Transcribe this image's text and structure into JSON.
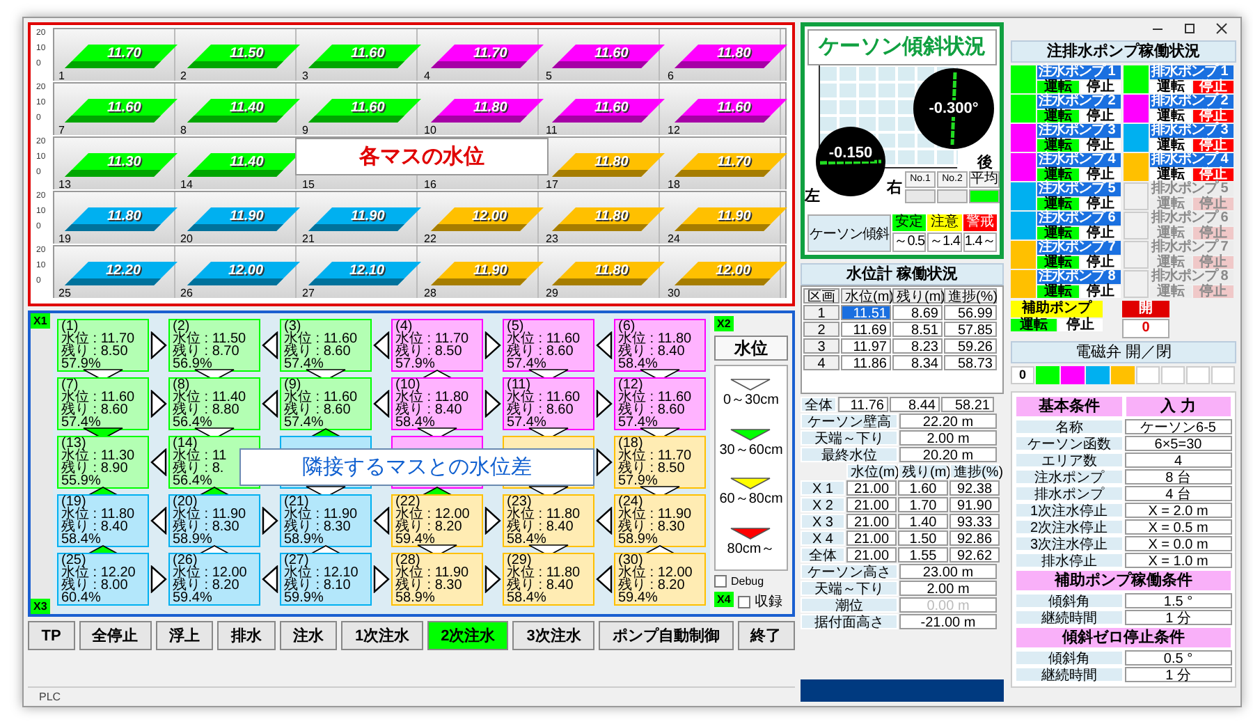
{
  "level_chart": {
    "overlay": "各マスの水位",
    "rows": [
      {
        "ticks": [
          "20",
          "10",
          "0"
        ],
        "bars": [
          {
            "index": "1",
            "value": "11.70",
            "color": "#00ff00"
          },
          {
            "index": "2",
            "value": "11.50",
            "color": "#00ff00"
          },
          {
            "index": "3",
            "value": "11.60",
            "color": "#00ff00"
          },
          {
            "index": "4",
            "value": "11.70",
            "color": "#ff00ff"
          },
          {
            "index": "5",
            "value": "11.60",
            "color": "#ff00ff"
          },
          {
            "index": "6",
            "value": "11.80",
            "color": "#ff00ff"
          }
        ]
      },
      {
        "ticks": [
          "20",
          "10",
          "0"
        ],
        "bars": [
          {
            "index": "7",
            "value": "11.60",
            "color": "#00ff00"
          },
          {
            "index": "8",
            "value": "11.40",
            "color": "#00ff00"
          },
          {
            "index": "9",
            "value": "11.60",
            "color": "#00ff00"
          },
          {
            "index": "10",
            "value": "11.80",
            "color": "#ff00ff"
          },
          {
            "index": "11",
            "value": "11.60",
            "color": "#ff00ff"
          },
          {
            "index": "12",
            "value": "11.60",
            "color": "#ff00ff"
          }
        ]
      },
      {
        "ticks": [
          "20",
          "10",
          "0"
        ],
        "bars": [
          {
            "index": "13",
            "value": "11.30",
            "color": "#00ff00"
          },
          {
            "index": "14",
            "value": "11.40",
            "color": "#00ff00"
          },
          {
            "index": "15"
          },
          {
            "index": "16"
          },
          {
            "index": "17",
            "value": "11.80",
            "color": "#ffc000"
          },
          {
            "index": "18",
            "value": "11.70",
            "color": "#ffc000"
          }
        ]
      },
      {
        "ticks": [
          "20",
          "10",
          "0"
        ],
        "bars": [
          {
            "index": "19",
            "value": "11.80",
            "color": "#00b0f0"
          },
          {
            "index": "20",
            "value": "11.90",
            "color": "#00b0f0"
          },
          {
            "index": "21",
            "value": "11.90",
            "color": "#00b0f0"
          },
          {
            "index": "22",
            "value": "12.00",
            "color": "#ffc000"
          },
          {
            "index": "23",
            "value": "11.80",
            "color": "#ffc000"
          },
          {
            "index": "24",
            "value": "11.90",
            "color": "#ffc000"
          }
        ]
      },
      {
        "ticks": [
          "20",
          "10",
          "0"
        ],
        "bars": [
          {
            "index": "25",
            "value": "12.20",
            "color": "#00b0f0"
          },
          {
            "index": "26",
            "value": "12.00",
            "color": "#00b0f0"
          },
          {
            "index": "27",
            "value": "12.10",
            "color": "#00b0f0"
          },
          {
            "index": "28",
            "value": "11.90",
            "color": "#ffc000"
          },
          {
            "index": "29",
            "value": "11.80",
            "color": "#ffc000"
          },
          {
            "index": "30",
            "value": "12.00",
            "color": "#ffc000"
          }
        ]
      }
    ]
  },
  "cell_grid": {
    "corners": [
      "X1",
      "X2",
      "X3",
      "X4"
    ],
    "overlay": "隣接するマスとの水位差",
    "rows": [
      {
        "cells": [
          {
            "index": "(1)",
            "level": "水位 : 11.70",
            "remain": "残り : 8.50",
            "progress": "57.9%",
            "color": "#00ff00"
          },
          {
            "index": "(2)",
            "level": "水位 : 11.50",
            "remain": "残り : 8.70",
            "progress": "56.9%",
            "color": "#00ff00"
          },
          {
            "index": "(3)",
            "level": "水位 : 11.60",
            "remain": "残り : 8.60",
            "progress": "57.4%",
            "color": "#00ff00"
          },
          {
            "index": "(4)",
            "level": "水位 : 11.70",
            "remain": "残り : 8.50",
            "progress": "57.9%",
            "color": "#ff00ff"
          },
          {
            "index": "(5)",
            "level": "水位 : 11.60",
            "remain": "残り : 8.60",
            "progress": "57.4%",
            "color": "#ff00ff"
          },
          {
            "index": "(6)",
            "level": "水位 : 11.80",
            "remain": "残り : 8.40",
            "progress": "58.4%",
            "color": "#ff00ff"
          }
        ],
        "arrows": [
          {
            "kind": "right"
          },
          {
            "kind": "left"
          },
          {
            "kind": "left"
          },
          {
            "kind": "right"
          },
          {
            "kind": "left"
          }
        ]
      },
      {
        "cells": [
          {
            "index": "(7)",
            "level": "水位 : 11.60",
            "remain": "残り : 8.60",
            "progress": "57.4%",
            "color": "#00ff00"
          },
          {
            "index": "(8)",
            "level": "水位 : 11.40",
            "remain": "残り : 8.80",
            "progress": "56.4%",
            "color": "#00ff00"
          },
          {
            "index": "(9)",
            "level": "水位 : 11.60",
            "remain": "残り : 8.60",
            "progress": "57.4%",
            "color": "#00ff00"
          },
          {
            "index": "(10)",
            "level": "水位 : 11.80",
            "remain": "残り : 8.40",
            "progress": "58.4%",
            "color": "#ff00ff"
          },
          {
            "index": "(11)",
            "level": "水位 : 11.60",
            "remain": "残り : 8.60",
            "progress": "57.4%",
            "color": "#ff00ff"
          },
          {
            "index": "(12)",
            "level": "水位 : 11.60",
            "remain": "残り : 8.60",
            "progress": "57.4%",
            "color": "#ff00ff"
          }
        ],
        "arrows": [
          {
            "kind": "right"
          },
          {
            "kind": "left"
          },
          {
            "kind": "left"
          },
          {
            "kind": "right"
          },
          {
            "kind": "right"
          }
        ]
      },
      {
        "cells": [
          {
            "index": "(13)",
            "level": "水位 : 11.30",
            "remain": "残り : 8.90",
            "progress": "55.9%",
            "color": "#00ff00"
          },
          {
            "index": "(14)",
            "level": "水位 : 11",
            "remain": "残り : 8.",
            "progress": "56.4%",
            "color": "#00ff00"
          },
          {
            "color": "#00b0f0"
          },
          {
            "color": "#ff00ff"
          },
          {
            "color": "#ffc000"
          },
          {
            "index": "(18)",
            "level": "水位 : 11.70",
            "remain": "残り : 8.50",
            "progress": "57.9%",
            "color": "#ffc000"
          }
        ],
        "arrows": [
          {
            "kind": "left"
          },
          null,
          null,
          null,
          {
            "kind": "right"
          }
        ]
      },
      {
        "cells": [
          {
            "index": "(19)",
            "level": "水位 : 11.80",
            "remain": "残り : 8.40",
            "progress": "58.4%",
            "color": "#00b0f0"
          },
          {
            "index": "(20)",
            "level": "水位 : 11.90",
            "remain": "残り : 8.30",
            "progress": "58.9%",
            "color": "#00b0f0"
          },
          {
            "index": "(21)",
            "level": "水位 : 11.90",
            "remain": "残り : 8.30",
            "progress": "58.9%",
            "color": "#00b0f0"
          },
          {
            "index": "(22)",
            "level": "水位 : 12.00",
            "remain": "残り : 8.20",
            "progress": "59.4%",
            "color": "#ffc000"
          },
          {
            "index": "(23)",
            "level": "水位 : 11.80",
            "remain": "残り : 8.40",
            "progress": "58.4%",
            "color": "#ffc000"
          },
          {
            "index": "(24)",
            "level": "水位 : 11.90",
            "remain": "残り : 8.30",
            "progress": "58.9%",
            "color": "#ffc000"
          }
        ],
        "arrows": [
          {
            "kind": "left"
          },
          {
            "kind": "right"
          },
          {
            "kind": "left"
          },
          {
            "kind": "right"
          },
          {
            "kind": "left"
          }
        ]
      },
      {
        "cells": [
          {
            "index": "(25)",
            "level": "水位 : 12.20",
            "remain": "残り : 8.00",
            "progress": "60.4%",
            "color": "#00b0f0"
          },
          {
            "index": "(26)",
            "level": "水位 : 12.00",
            "remain": "残り : 8.20",
            "progress": "59.4%",
            "color": "#00b0f0"
          },
          {
            "index": "(27)",
            "level": "水位 : 12.10",
            "remain": "残り : 8.10",
            "progress": "59.9%",
            "color": "#00b0f0"
          },
          {
            "index": "(28)",
            "level": "水位 : 11.90",
            "remain": "残り : 8.30",
            "progress": "58.9%",
            "color": "#ffc000"
          },
          {
            "index": "(29)",
            "level": "水位 : 11.80",
            "remain": "残り : 8.40",
            "progress": "58.4%",
            "color": "#ffc000"
          },
          {
            "index": "(30)",
            "level": "水位 : 12.00",
            "remain": "残り : 8.20",
            "progress": "59.4%",
            "color": "#ffc000"
          }
        ],
        "arrows": [
          {
            "kind": "right"
          },
          {
            "kind": "left"
          },
          {
            "kind": "right"
          },
          {
            "kind": "right"
          },
          {
            "kind": "left"
          }
        ]
      }
    ],
    "v_arrows": [
      [
        {
          "kind": "down",
          "color": "#ffffff"
        },
        {
          "kind": "down",
          "color": "#ffffff"
        },
        {
          "kind": "down",
          "color": "#ffffff"
        },
        {
          "kind": "up",
          "color": "#ffffff"
        },
        {
          "kind": "down",
          "color": "#ffffff"
        },
        {
          "kind": "down",
          "color": "#ffffff"
        }
      ],
      [
        {
          "kind": "down",
          "color": "#00ff00"
        },
        {
          "kind": "down",
          "color": "#ffffff"
        },
        {
          "kind": "up",
          "color": "#00ff00"
        },
        {
          "kind": "down",
          "color": "#ffffff"
        },
        {
          "kind": "down",
          "color": "#ffffff"
        },
        {
          "kind": "down",
          "color": "#ffffff"
        }
      ],
      [
        {
          "kind": "up",
          "color": "#00ff00"
        },
        {
          "kind": "up",
          "color": "#00ff00"
        },
        {
          "kind": "down",
          "color": "#ffffff"
        },
        {
          "kind": "up",
          "color": "#00ff00"
        },
        {
          "kind": "down",
          "color": "#ffffff"
        },
        {
          "kind": "down",
          "color": "#ffffff"
        }
      ],
      [
        {
          "kind": "up",
          "color": "#00ff00"
        },
        {
          "kind": "up",
          "color": "#ffffff"
        },
        {
          "kind": "up",
          "color": "#ffffff"
        },
        {
          "kind": "down",
          "color": "#ffffff"
        },
        {
          "kind": "down",
          "color": "#ffffff"
        },
        {
          "kind": "up",
          "color": "#ffffff"
        }
      ]
    ],
    "legend_button": "水位",
    "legend": [
      {
        "label": "0～30cm",
        "color": "#ffffff"
      },
      {
        "label": "30～60cm",
        "color": "#00ff00"
      },
      {
        "label": "60～80cm",
        "color": "#ffff00"
      },
      {
        "label": "80cm～",
        "color": "#ff0000"
      }
    ],
    "debug": {
      "label": "Debug",
      "checked": false
    },
    "record": {
      "label": "収録",
      "checked": false
    }
  },
  "commands": [
    {
      "label": "TP",
      "selected": false
    },
    {
      "label": "全停止",
      "selected": false
    },
    {
      "label": "浮上",
      "selected": false
    },
    {
      "label": "排水",
      "selected": false
    },
    {
      "label": "注水",
      "selected": false
    },
    {
      "label": "1次注水",
      "selected": false
    },
    {
      "label": "2次注水",
      "selected": true
    },
    {
      "label": "3次注水",
      "selected": false
    },
    {
      "label": "ポンプ自動制御",
      "selected": false
    },
    {
      "label": "終了",
      "selected": false
    }
  ],
  "status_bar": {
    "text": "PLC"
  },
  "tilt": {
    "title": "ケーソン傾斜状況",
    "back_value": "-0.300°",
    "side_value": "-0.150",
    "back_label": "後",
    "left_label": "左",
    "right_label": "右",
    "sensors": [
      {
        "label": "No.1",
        "kind": "off"
      },
      {
        "label": "No.2",
        "kind": "off"
      },
      {
        "label": "平均",
        "kind": "safe"
      }
    ],
    "caption": "ケーソン傾斜",
    "legend": [
      {
        "label": "安定",
        "range": "～0.5",
        "kind": "safe"
      },
      {
        "label": "注意",
        "range": "～1.4",
        "kind": "caution"
      },
      {
        "label": "警戒",
        "range": "1.4～",
        "kind": "alert"
      }
    ]
  },
  "gauge": {
    "title": "水位計 稼働状況",
    "columns": [
      "区画",
      "水位(m)",
      "残り(m)",
      "進捗(%)"
    ],
    "rows": [
      {
        "cells": [
          "1",
          "11.51",
          "8.69",
          "56.99"
        ],
        "selected": true
      },
      {
        "cells": [
          "2",
          "11.69",
          "8.51",
          "57.85"
        ],
        "selected": false
      },
      {
        "cells": [
          "3",
          "11.97",
          "8.23",
          "59.26"
        ],
        "selected": false
      },
      {
        "cells": [
          "4",
          "11.86",
          "8.34",
          "58.73"
        ],
        "selected": false
      }
    ],
    "total": {
      "label": "全体",
      "cells": [
        "11.76",
        "8.44",
        "58.21"
      ]
    },
    "wall": [
      {
        "label": "ケーソン壁高",
        "value": "22.20 m"
      },
      {
        "label": "天端～下り",
        "value": "2.00 m"
      },
      {
        "label": "最終水位",
        "value": "20.20 m"
      }
    ],
    "x_columns": [
      "水位(m)",
      "残り(m)",
      "進捗(%)"
    ],
    "x_rows": [
      {
        "label": "X 1",
        "cells": [
          "21.00",
          "1.60",
          "92.38"
        ]
      },
      {
        "label": "X 2",
        "cells": [
          "21.00",
          "1.70",
          "91.90"
        ]
      },
      {
        "label": "X 3",
        "cells": [
          "21.00",
          "1.40",
          "93.33"
        ]
      },
      {
        "label": "X 4",
        "cells": [
          "21.00",
          "1.50",
          "92.86"
        ]
      },
      {
        "label": "全体",
        "cells": [
          "21.00",
          "1.55",
          "92.62"
        ]
      }
    ],
    "heights": [
      {
        "label": "ケーソン高さ",
        "value": "23.00 m",
        "disabled": false
      },
      {
        "label": "天端～下り",
        "value": "2.00 m",
        "disabled": false
      },
      {
        "label": "潮位",
        "value": "0.00 m",
        "disabled": true
      },
      {
        "label": "据付面高さ",
        "value": "-21.00 m",
        "disabled": false
      }
    ]
  },
  "pumps": {
    "title": "注排水ポンプ稼働状況",
    "injection": [
      {
        "name": "注水ポンプ 1",
        "color": "#00ff00",
        "run_label": "運転",
        "stop_label": "停止",
        "running": true,
        "disabled": false
      },
      {
        "name": "注水ポンプ 2",
        "color": "#00ff00",
        "run_label": "運転",
        "stop_label": "停止",
        "running": true,
        "disabled": false
      },
      {
        "name": "注水ポンプ 3",
        "color": "#ff00ff",
        "run_label": "運転",
        "stop_label": "停止",
        "running": true,
        "disabled": false
      },
      {
        "name": "注水ポンプ 4",
        "color": "#ff00ff",
        "run_label": "運転",
        "stop_label": "停止",
        "running": true,
        "disabled": false
      },
      {
        "name": "注水ポンプ 5",
        "color": "#00b0f0",
        "run_label": "運転",
        "stop_label": "停止",
        "running": true,
        "disabled": false
      },
      {
        "name": "注水ポンプ 6",
        "color": "#00b0f0",
        "run_label": "運転",
        "stop_label": "停止",
        "running": true,
        "disabled": false
      },
      {
        "name": "注水ポンプ 7",
        "color": "#ffc000",
        "run_label": "運転",
        "stop_label": "停止",
        "running": true,
        "disabled": false
      },
      {
        "name": "注水ポンプ 8",
        "color": "#ffc000",
        "run_label": "運転",
        "stop_label": "停止",
        "running": true,
        "disabled": false
      }
    ],
    "drain": [
      {
        "name": "排水ポンプ 1",
        "color": "#00ff00",
        "run_label": "運転",
        "stop_label": "停止",
        "running": false,
        "disabled": false
      },
      {
        "name": "排水ポンプ 2",
        "color": "#ff00ff",
        "run_label": "運転",
        "stop_label": "停止",
        "running": false,
        "disabled": false
      },
      {
        "name": "排水ポンプ 3",
        "color": "#00b0f0",
        "run_label": "運転",
        "stop_label": "停止",
        "running": false,
        "disabled": false
      },
      {
        "name": "排水ポンプ 4",
        "color": "#ffc000",
        "run_label": "運転",
        "stop_label": "停止",
        "running": false,
        "disabled": false
      },
      {
        "name": "排水ポンプ 5",
        "run_label": "運転",
        "stop_label": "停止",
        "running": false,
        "disabled": true
      },
      {
        "name": "排水ポンプ 6",
        "run_label": "運転",
        "stop_label": "停止",
        "running": false,
        "disabled": true
      },
      {
        "name": "排水ポンプ 7",
        "run_label": "運転",
        "stop_label": "停止",
        "running": false,
        "disabled": true
      },
      {
        "name": "排水ポンプ 8",
        "run_label": "運転",
        "stop_label": "停止",
        "running": false,
        "disabled": true
      }
    ],
    "aux": {
      "label": "補助ポンプ",
      "run_label": "運転",
      "stop_label": "停止",
      "running": true
    },
    "valve": {
      "label": "開",
      "count": "0",
      "open": true
    },
    "solenoid": {
      "title": "電磁弁 開／閉",
      "count": "0",
      "slots": [
        {
          "on": true,
          "color": "#00ff00"
        },
        {
          "on": true,
          "color": "#ff00ff"
        },
        {
          "on": true,
          "color": "#00b0f0"
        },
        {
          "on": true,
          "color": "#ffc000"
        },
        {
          "on": false
        },
        {
          "on": false
        },
        {
          "on": false
        },
        {
          "on": false
        }
      ]
    }
  },
  "conditions": {
    "headers": [
      "基本条件",
      "入 力"
    ],
    "rows": [
      {
        "label": "名称",
        "value": "ケーソン6-5"
      },
      {
        "label": "ケーソン函数",
        "value": "6×5=30"
      },
      {
        "label": "エリア数",
        "value": "4"
      },
      {
        "label": "注水ポンプ",
        "value": "8 台"
      },
      {
        "label": "排水ポンプ",
        "value": "4 台"
      },
      {
        "label": "1次注水停止",
        "value": "X = 2.0 m"
      },
      {
        "label": "2次注水停止",
        "value": "X = 0.5 m"
      },
      {
        "label": "3次注水停止",
        "value": "X = 0.0 m"
      },
      {
        "label": "排水停止",
        "value": "X = 1.0 m"
      }
    ],
    "sections": [
      {
        "title": "補助ポンプ稼働条件",
        "rows": [
          {
            "label": "傾斜角",
            "value": "1.5 °"
          },
          {
            "label": "継続時間",
            "value": "1 分"
          }
        ]
      },
      {
        "title": "傾斜ゼロ停止条件",
        "rows": [
          {
            "label": "傾斜角",
            "value": "0.5 °"
          },
          {
            "label": "継続時間",
            "value": "1 分"
          }
        ]
      }
    ]
  }
}
